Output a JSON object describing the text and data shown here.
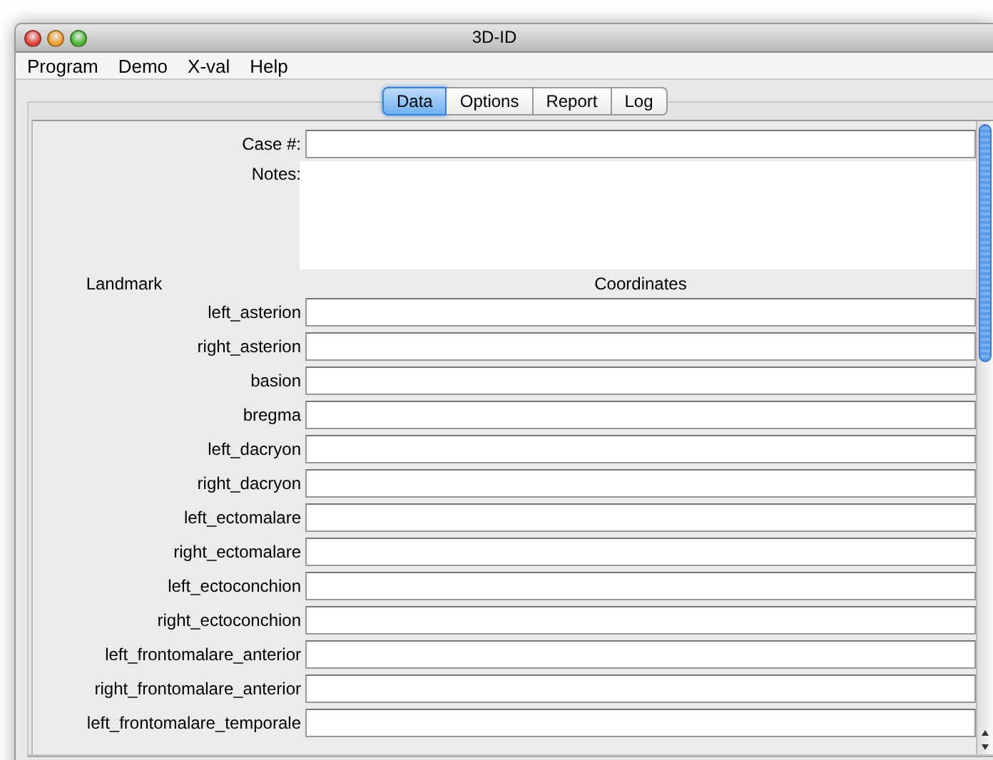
{
  "window": {
    "title": "3D-ID"
  },
  "menu": [
    "Program",
    "Demo",
    "X-val",
    "Help"
  ],
  "tabs": [
    {
      "label": "Data",
      "selected": true
    },
    {
      "label": "Options",
      "selected": false
    },
    {
      "label": "Report",
      "selected": false
    },
    {
      "label": "Log",
      "selected": false
    }
  ],
  "case_field": {
    "label": "Case #:"
  },
  "notes_field": {
    "label": "Notes:"
  },
  "columns": [
    "Landmark",
    "Coordinates"
  ],
  "landmarks": [
    "left_asterion",
    "right_asterion",
    "basion",
    "bregma",
    "left_dacryon",
    "right_dacryon",
    "left_ectomalare",
    "right_ectomalare",
    "left_ectoconchion",
    "right_ectoconchion",
    "left_frontomalare_anterior",
    "right_frontomalare_anterior",
    "left_frontomalare_temporale"
  ]
}
